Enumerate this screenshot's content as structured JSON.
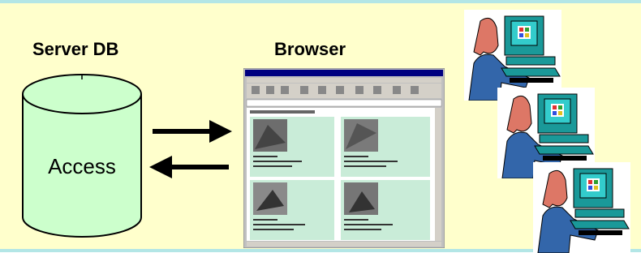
{
  "labels": {
    "server_db": "Server DB",
    "browser": "Browser",
    "database_name": "Access"
  },
  "colors": {
    "background": "#ffffcc",
    "band": "#b3e6e6",
    "cylinder": "#ccffcc",
    "screen": "#33cccc",
    "sweater": "#3366aa",
    "skin": "#dd7766"
  },
  "icons": {
    "database": "cylinder-icon",
    "arrows": "bidirectional-arrows",
    "browser": "browser-window-screenshot",
    "user": "user-at-computer-icon"
  }
}
